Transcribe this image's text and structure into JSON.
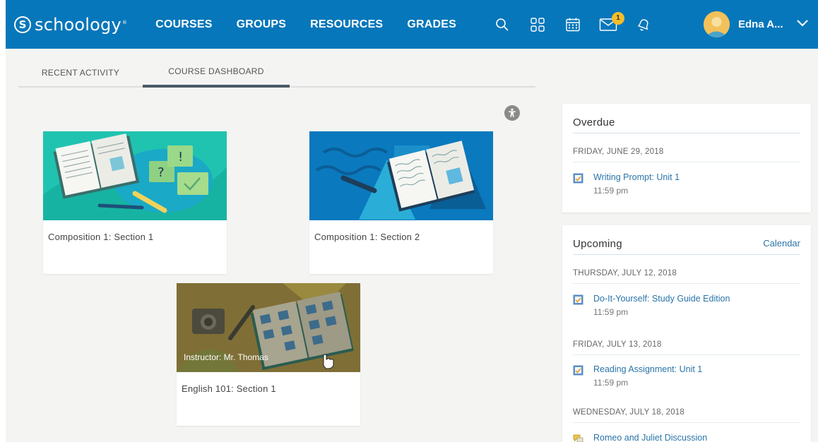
{
  "header": {
    "logo_text": "schoology",
    "logo_mark": "S",
    "logo_tm": "®",
    "nav": [
      "COURSES",
      "GROUPS",
      "RESOURCES",
      "GRADES"
    ],
    "icons": [
      "search-icon",
      "apps-grid-icon",
      "calendar-icon",
      "mail-icon",
      "bell-icon"
    ],
    "mail_badge": "1",
    "user_name": "Edna A..."
  },
  "tabs": {
    "recent": "RECENT ACTIVITY",
    "dashboard": "COURSE DASHBOARD",
    "active": "COURSE DASHBOARD"
  },
  "courses": [
    {
      "title": "Composition 1: Section 1",
      "color": "#20c3b0"
    },
    {
      "title": "Composition 1: Section 2",
      "color": "#0b79bd"
    },
    {
      "title": "English 101: Section 1",
      "color": "#8a7a3a",
      "instructor": "Instructor: Mr. Thomas"
    }
  ],
  "overdue": {
    "title": "Overdue",
    "groups": [
      {
        "date": "FRIDAY, JUNE 29, 2018",
        "items": [
          {
            "title": "Writing Prompt: Unit 1",
            "time": "11:59 pm"
          }
        ]
      }
    ]
  },
  "upcoming": {
    "title": "Upcoming",
    "calendar_link": "Calendar",
    "groups": [
      {
        "date": "THURSDAY, JULY 12, 2018",
        "items": [
          {
            "title": "Do-It-Yourself: Study Guide Edition",
            "time": "11:59 pm"
          }
        ]
      },
      {
        "date": "FRIDAY, JULY 13, 2018",
        "items": [
          {
            "title": "Reading Assignment: Unit 1",
            "time": "11:59 pm"
          }
        ]
      },
      {
        "date": "WEDNESDAY, JULY 18, 2018",
        "items": [
          {
            "title": "Romeo and Juliet Discussion"
          }
        ]
      }
    ]
  },
  "colors": {
    "nav_bg": "#0677ba",
    "link": "#2a74a8",
    "badge": "#f4bd2a"
  }
}
